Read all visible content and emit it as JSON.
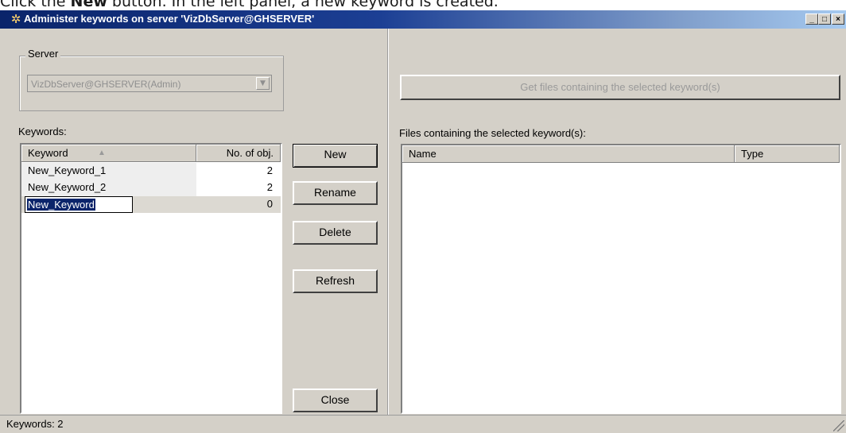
{
  "caption": {
    "prefix": "Click the ",
    "bold": "New",
    "suffix": " button. In the left panel, a new keyword is created."
  },
  "window": {
    "title": "Administer keywords on server 'VizDbServer@GHSERVER'",
    "controls": [
      "_",
      "□",
      "×"
    ]
  },
  "server": {
    "group_label": "Server",
    "selected": "VizDbServer@GHSERVER(Admin)"
  },
  "keywords": {
    "label": "Keywords:",
    "col_keyword": "Keyword",
    "col_count": "No. of obj.",
    "rows": [
      {
        "keyword": "New_Keyword_1",
        "count": "2"
      },
      {
        "keyword": "New_Keyword_2",
        "count": "2"
      },
      {
        "keyword": "New_Keyword",
        "count": "0"
      }
    ]
  },
  "buttons": {
    "new": "New",
    "rename": "Rename",
    "delete": "Delete",
    "refresh": "Refresh",
    "close": "Close"
  },
  "files": {
    "get_button": "Get files containing the selected keyword(s)",
    "label": "Files containing the selected keyword(s):",
    "col_name": "Name",
    "col_type": "Type"
  },
  "status": {
    "text": "Keywords: 2"
  },
  "colors": {
    "title_start": "#0a246a",
    "title_end": "#a6caf0",
    "selection": "#0a246a",
    "face": "#d4d0c8"
  }
}
